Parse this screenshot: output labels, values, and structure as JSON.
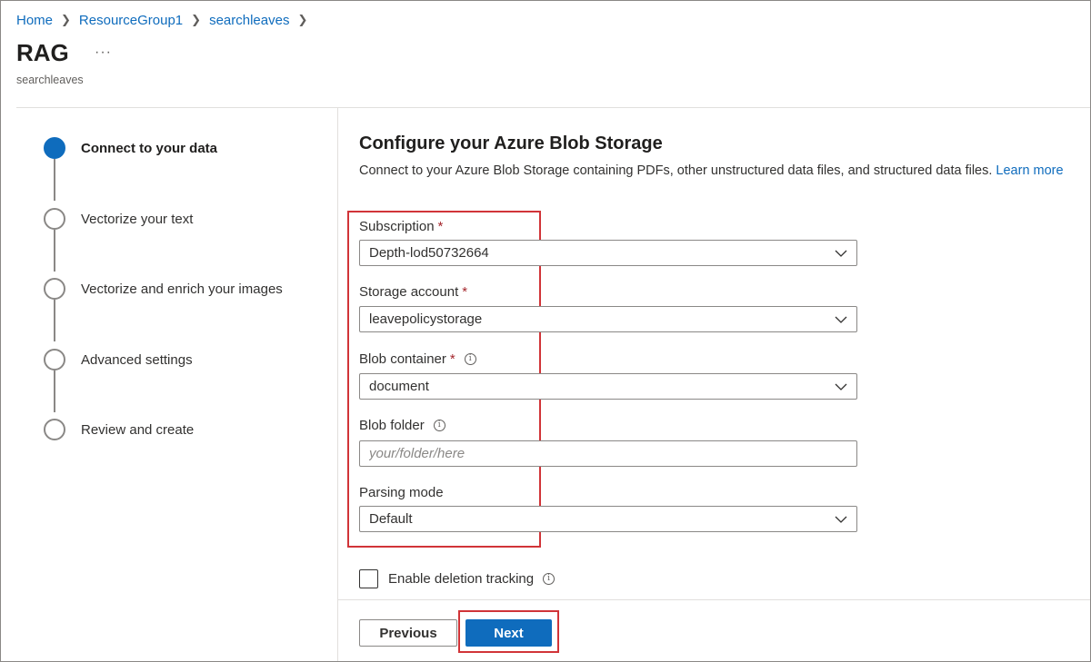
{
  "breadcrumb": [
    "Home",
    "ResourceGroup1",
    "searchleaves"
  ],
  "header": {
    "title": "RAG",
    "subtitle": "searchleaves",
    "more_label": "···"
  },
  "steps": [
    {
      "label": "Connect to your data",
      "active": true
    },
    {
      "label": "Vectorize your text",
      "active": false
    },
    {
      "label": "Vectorize and enrich your images",
      "active": false
    },
    {
      "label": "Advanced settings",
      "active": false
    },
    {
      "label": "Review and create",
      "active": false
    }
  ],
  "form": {
    "title": "Configure your Azure Blob Storage",
    "description": "Connect to your Azure Blob Storage containing PDFs, other unstructured data files, and structured data files.",
    "learn_more": "Learn more",
    "subscription": {
      "label": "Subscription",
      "required_mark": "*",
      "value": "Depth-lod50732664"
    },
    "storage_account": {
      "label": "Storage account",
      "required_mark": "*",
      "value": "leavepolicystorage"
    },
    "blob_container": {
      "label": "Blob container",
      "required_mark": "*",
      "value": "document"
    },
    "blob_folder": {
      "label": "Blob folder",
      "placeholder": "your/folder/here",
      "value": ""
    },
    "parsing_mode": {
      "label": "Parsing mode",
      "value": "Default"
    },
    "deletion_tracking": {
      "label": "Enable deletion tracking",
      "checked": false
    }
  },
  "footer": {
    "previous_label": "Previous",
    "next_label": "Next"
  },
  "colors": {
    "accent": "#0f6cbd",
    "highlight": "#d13438"
  }
}
